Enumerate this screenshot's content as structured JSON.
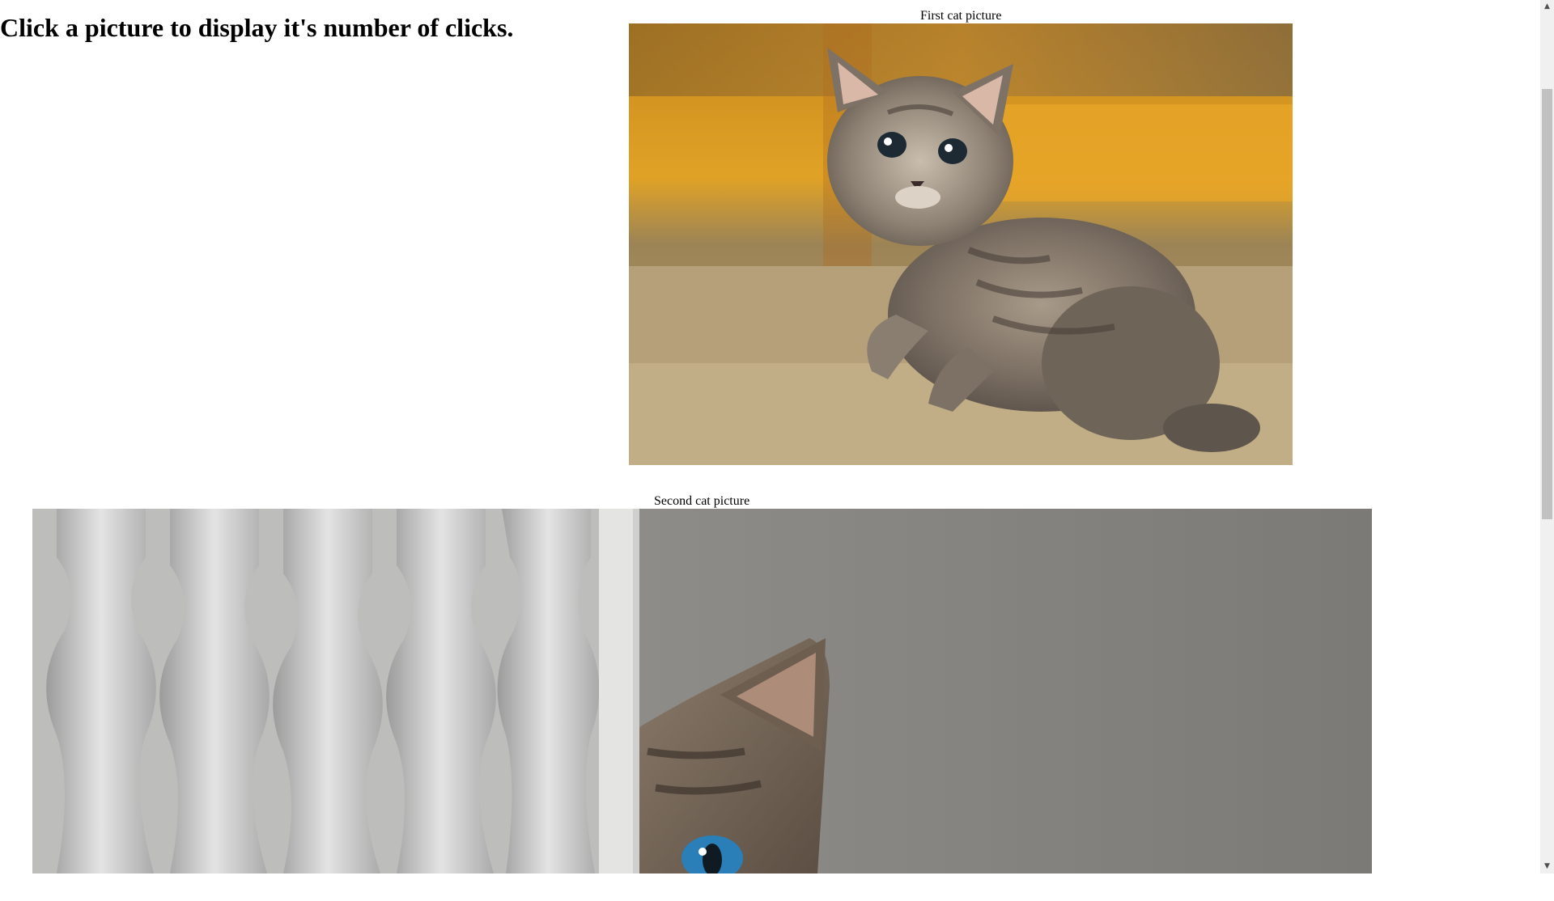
{
  "heading": "Click a picture to display it's number of clicks.",
  "pictures": [
    {
      "caption": "First cat picture",
      "subject": "tabby kitten sitting on carpet"
    },
    {
      "caption": "Second cat picture",
      "subject": "tabby cat peeking from behind white banister"
    }
  ],
  "scrollbar": {
    "up_arrow": "▲",
    "down_arrow": "▼"
  }
}
